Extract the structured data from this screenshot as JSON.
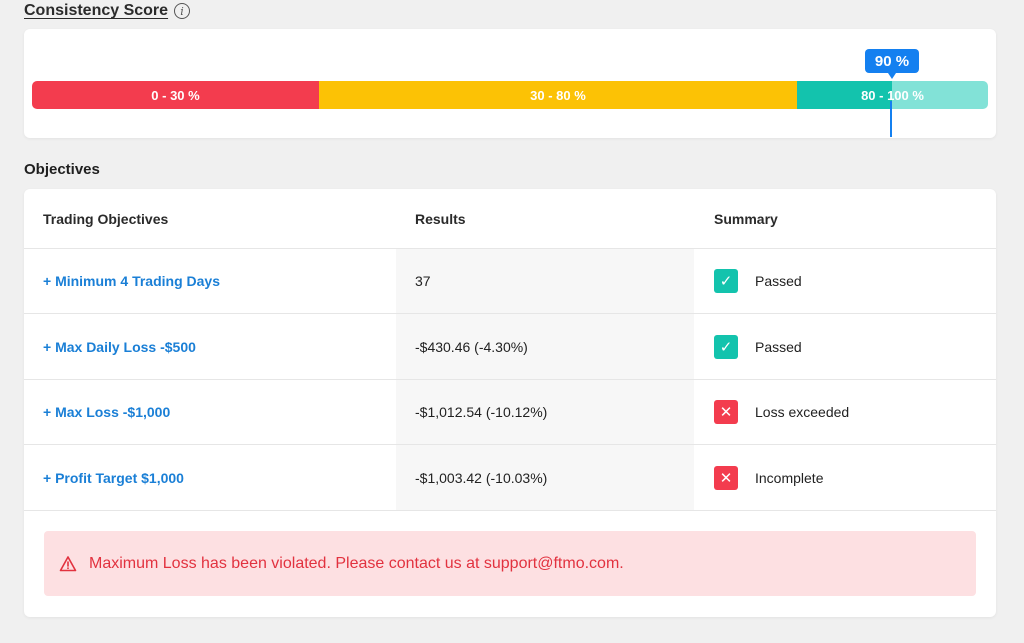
{
  "consistency": {
    "title": "Consistency Score",
    "info_icon": "i",
    "segments": [
      {
        "label": "0 - 30 %",
        "color": "#f33c4e"
      },
      {
        "label": "30 - 80 %",
        "color": "#fcc205"
      },
      {
        "label": "80 - 100 %",
        "color": "#13c3ad"
      }
    ],
    "score_label": "90 %",
    "score_value": 90,
    "marker_color": "#1480f0"
  },
  "objectives": {
    "title": "Objectives",
    "headers": {
      "objective": "Trading Objectives",
      "results": "Results",
      "summary": "Summary"
    },
    "rows": [
      {
        "objective": "+ Minimum 4 Trading Days",
        "result": "37",
        "status": "Passed",
        "status_icon": "check-icon"
      },
      {
        "objective": "+ Max Daily Loss -$500",
        "result": "-$430.46 (-4.30%)",
        "status": "Passed",
        "status_icon": "check-icon"
      },
      {
        "objective": "+ Max Loss -$1,000",
        "result": "-$1,012.54 (-10.12%)",
        "status": "Loss exceeded",
        "status_icon": "cross-icon"
      },
      {
        "objective": "+ Profit Target $1,000",
        "result": "-$1,003.42 (-10.03%)",
        "status": "Incomplete",
        "status_icon": "cross-icon"
      }
    ],
    "pass_glyph": "✓",
    "fail_glyph": "✕",
    "alert": {
      "icon": "warning-triangle-icon",
      "text": "Maximum Loss has been violated. Please contact us at support@ftmo.com."
    }
  },
  "colors": {
    "accent_blue": "#1480f0",
    "link_blue": "#1a7fd6",
    "pass_teal": "#13c3ad",
    "fail_red": "#f33c4e",
    "warning_yellow": "#fcc205",
    "alert_bg": "#fde0e2"
  }
}
